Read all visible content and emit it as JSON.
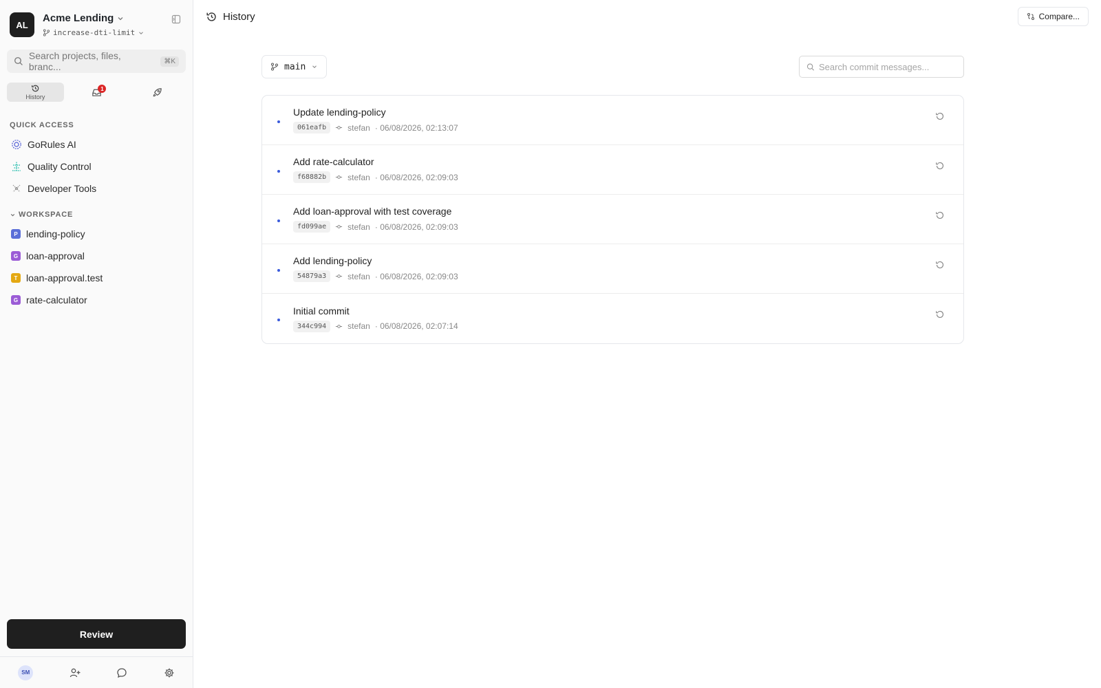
{
  "workspace": {
    "avatar_initials": "AL",
    "name": "Acme Lending",
    "branch": "increase-dti-limit"
  },
  "search": {
    "placeholder": "Search projects, files, branc...",
    "shortcut": "⌘K"
  },
  "tabs": [
    {
      "label": "History",
      "icon": "history-icon",
      "active": true
    },
    {
      "label": "",
      "icon": "inbox-icon",
      "badge": "1"
    },
    {
      "label": "",
      "icon": "rocket-icon"
    }
  ],
  "quick_access": {
    "title": "QUICK ACCESS",
    "items": [
      {
        "label": "GoRules AI",
        "icon": "ai-icon",
        "color": "#4f5bd5"
      },
      {
        "label": "Quality Control",
        "icon": "quality-icon",
        "color": "#14b8a6"
      },
      {
        "label": "Developer Tools",
        "icon": "dev-tools-icon",
        "color": "#888888"
      }
    ]
  },
  "workspace_section": {
    "title": "WORKSPACE",
    "items": [
      {
        "label": "lending-policy",
        "badge": "P",
        "color": "#5b6fd8"
      },
      {
        "label": "loan-approval",
        "badge": "G",
        "color": "#9b5cd6"
      },
      {
        "label": "loan-approval.test",
        "badge": "T",
        "color": "#e4a812"
      },
      {
        "label": "rate-calculator",
        "badge": "G",
        "color": "#9b5cd6"
      }
    ]
  },
  "review_button": "Review",
  "user": {
    "initials": "SM"
  },
  "page": {
    "title": "History",
    "compare_label": "Compare..."
  },
  "branch_select": {
    "value": "main"
  },
  "commit_search": {
    "placeholder": "Search commit messages..."
  },
  "commits": [
    {
      "title": "Update lending-policy",
      "hash": "061eafb",
      "author": "stefan",
      "date": "· 06/08/2026, 02:13:07"
    },
    {
      "title": "Add rate-calculator",
      "hash": "f68882b",
      "author": "stefan",
      "date": "· 06/08/2026, 02:09:03"
    },
    {
      "title": "Add loan-approval with test coverage",
      "hash": "fd099ae",
      "author": "stefan",
      "date": "· 06/08/2026, 02:09:03"
    },
    {
      "title": "Add lending-policy",
      "hash": "54879a3",
      "author": "stefan",
      "date": "· 06/08/2026, 02:09:03"
    },
    {
      "title": "Initial commit",
      "hash": "344c994",
      "author": "stefan",
      "date": "· 06/08/2026, 02:07:14"
    }
  ],
  "colors": {
    "accent": "#3b5bdb",
    "primary_button": "#1f1f1f",
    "badge_red": "#dc2626"
  }
}
